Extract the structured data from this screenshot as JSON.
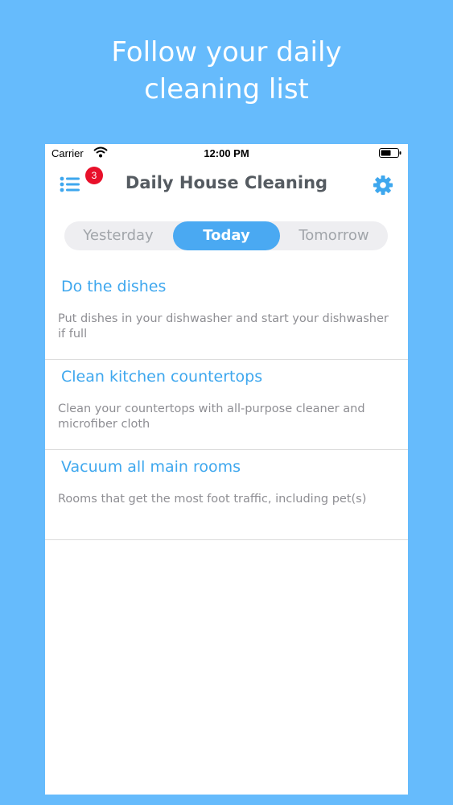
{
  "headline": {
    "line1": "Follow your daily",
    "line2": "cleaning list"
  },
  "status_bar": {
    "carrier": "Carrier",
    "time": "12:00 PM",
    "wifi_icon": "wifi-icon",
    "battery_icon": "battery-icon"
  },
  "nav": {
    "title": "Daily House Cleaning",
    "badge_count": "3",
    "menu_icon": "list-icon",
    "settings_icon": "gear-icon"
  },
  "segments": {
    "yesterday": "Yesterday",
    "today": "Today",
    "tomorrow": "Tomorrow",
    "selected": "Today"
  },
  "tasks": [
    {
      "title": "Do the dishes",
      "description": "Put dishes in your dishwasher and start your dishwasher if full"
    },
    {
      "title": "Clean kitchen countertops",
      "description": "Clean your countertops with all-purpose cleaner and microfiber cloth"
    },
    {
      "title": "Vacuum all main rooms",
      "description": "Rooms that get the most foot traffic, including pet(s)"
    }
  ],
  "colors": {
    "background": "#66bbfc",
    "accent": "#4aa9f2",
    "task_title": "#3ea7ee",
    "badge": "#e8102a"
  }
}
